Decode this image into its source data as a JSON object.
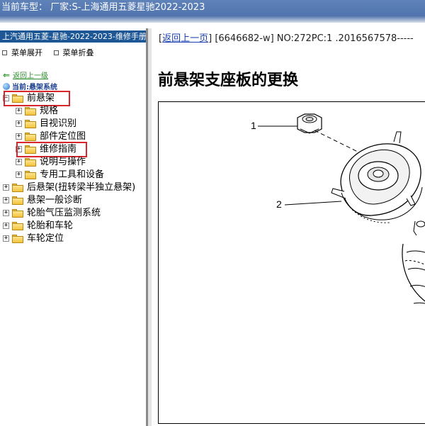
{
  "window": {
    "title_prefix": "当前车型：",
    "title_maker": "厂家:S-上海通用五菱星驰2022-2023"
  },
  "sidebar": {
    "header": "上汽通用五菱-星驰-2022-2023-维修手册",
    "menu": {
      "expand": "菜单展开",
      "collapse": "菜单折叠"
    },
    "back_label": "返回上一级",
    "current_path": "当前:悬架系统",
    "tree": [
      {
        "label": "前悬架",
        "level": 0,
        "expanded": true,
        "highlight": true
      },
      {
        "label": "规格",
        "level": 1
      },
      {
        "label": "目视识别",
        "level": 1
      },
      {
        "label": "部件定位图",
        "level": 1
      },
      {
        "label": "维修指南",
        "level": 1,
        "highlight": true
      },
      {
        "label": "说明与操作",
        "level": 1
      },
      {
        "label": "专用工具和设备",
        "level": 1
      },
      {
        "label": "后悬架(扭转梁半独立悬架)",
        "level": 0
      },
      {
        "label": "悬架一般诊断",
        "level": 0
      },
      {
        "label": "轮胎气压监测系统",
        "level": 0
      },
      {
        "label": "轮胎和车轮",
        "level": 0
      },
      {
        "label": "车轮定位",
        "level": 0
      }
    ]
  },
  "content": {
    "back_link": "返回上一页",
    "doc_info": "[6646682-w] NO:272PC:1 .2016567578-----",
    "page_title": "前悬架支座板的更换",
    "figure": {
      "callout_1": "1",
      "callout_2": "2"
    }
  }
}
